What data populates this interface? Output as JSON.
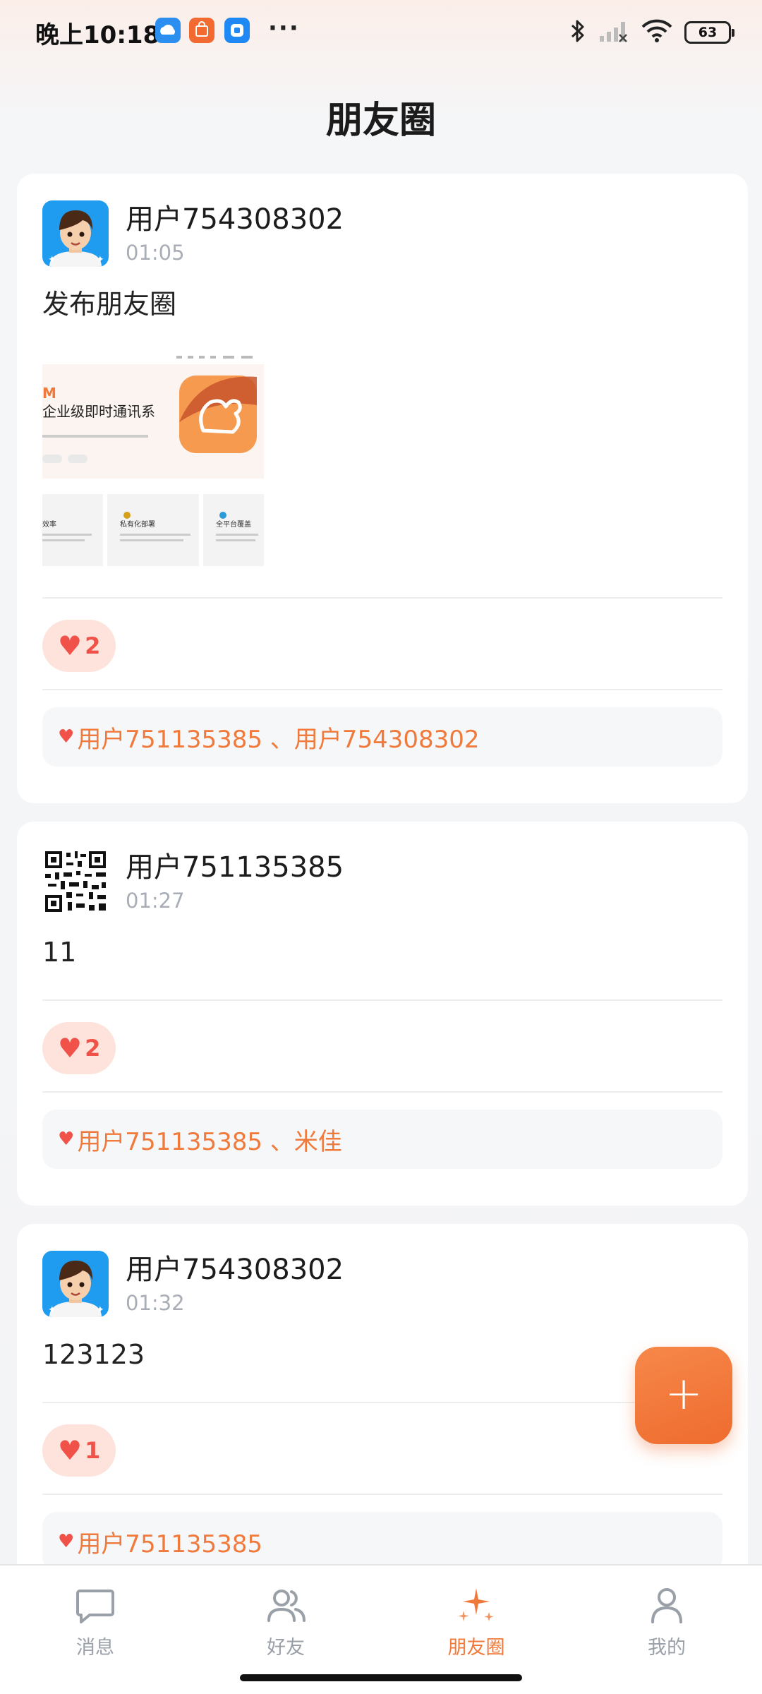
{
  "status_bar": {
    "time": "晚上10:18",
    "dots": "···",
    "battery": "63",
    "icons": [
      "cloud-app-icon",
      "mi-store-icon",
      "blue-app-icon",
      "bluetooth-icon",
      "signal-icon",
      "wifi-icon",
      "battery-icon"
    ]
  },
  "header": {
    "title": "朋友圈"
  },
  "posts": [
    {
      "username": "用户754308302",
      "time": "01:05",
      "content": "发布朋友圈",
      "likes": "2",
      "liked_by": "用户751135385 、用户754308302"
    },
    {
      "username": "用户751135385",
      "time": "01:27",
      "content": "11",
      "likes": "2",
      "liked_by": "用户751135385 、米佳"
    },
    {
      "username": "用户754308302",
      "time": "01:32",
      "content": "123123",
      "likes": "1",
      "liked_by": "用户751135385"
    }
  ],
  "image_preview": {
    "logo_letter": "M",
    "headline": "企业级即时通讯系",
    "cards": [
      "效率",
      "私有化部署",
      "全平台覆盖"
    ]
  },
  "fab": {
    "label": "+"
  },
  "tabs": [
    {
      "label": "消息",
      "icon": "message-icon"
    },
    {
      "label": "好友",
      "icon": "friends-icon"
    },
    {
      "label": "朋友圈",
      "icon": "moments-icon"
    },
    {
      "label": "我的",
      "icon": "profile-icon"
    }
  ],
  "colors": {
    "accent": "#f07a3c",
    "like_red": "#f0524a",
    "like_bg": "#fde3dc"
  }
}
